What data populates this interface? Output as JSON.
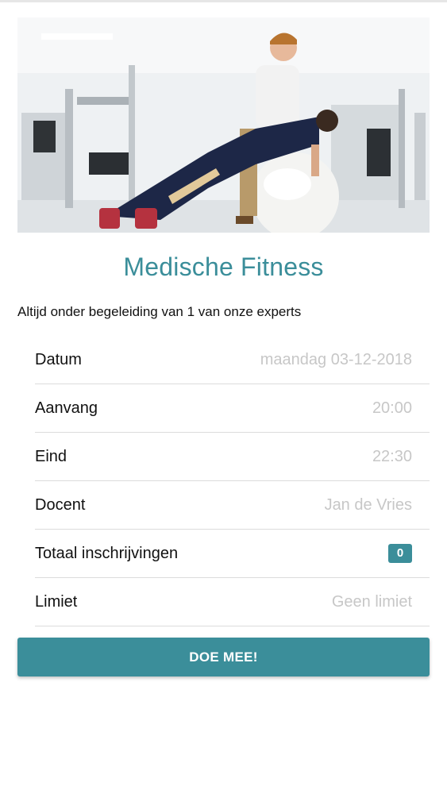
{
  "hero": {
    "image_name": "medical-fitness-photo"
  },
  "class": {
    "title": "Medische Fitness",
    "subtitle": "Altijd onder begeleiding van 1 van onze experts"
  },
  "details": [
    {
      "label": "Datum",
      "value": "maandag 03-12-2018"
    },
    {
      "label": "Aanvang",
      "value": "20:00"
    },
    {
      "label": "Eind",
      "value": "22:30"
    },
    {
      "label": "Docent",
      "value": "Jan de Vries"
    },
    {
      "label": "Totaal inschrijvingen",
      "value": "0"
    },
    {
      "label": "Limiet",
      "value": "Geen limiet"
    }
  ],
  "actions": {
    "join_label": "DOE MEE!"
  },
  "colors": {
    "accent": "#3b8e9a",
    "value_text": "#c7c7c7",
    "divider": "#dcdcdc"
  }
}
